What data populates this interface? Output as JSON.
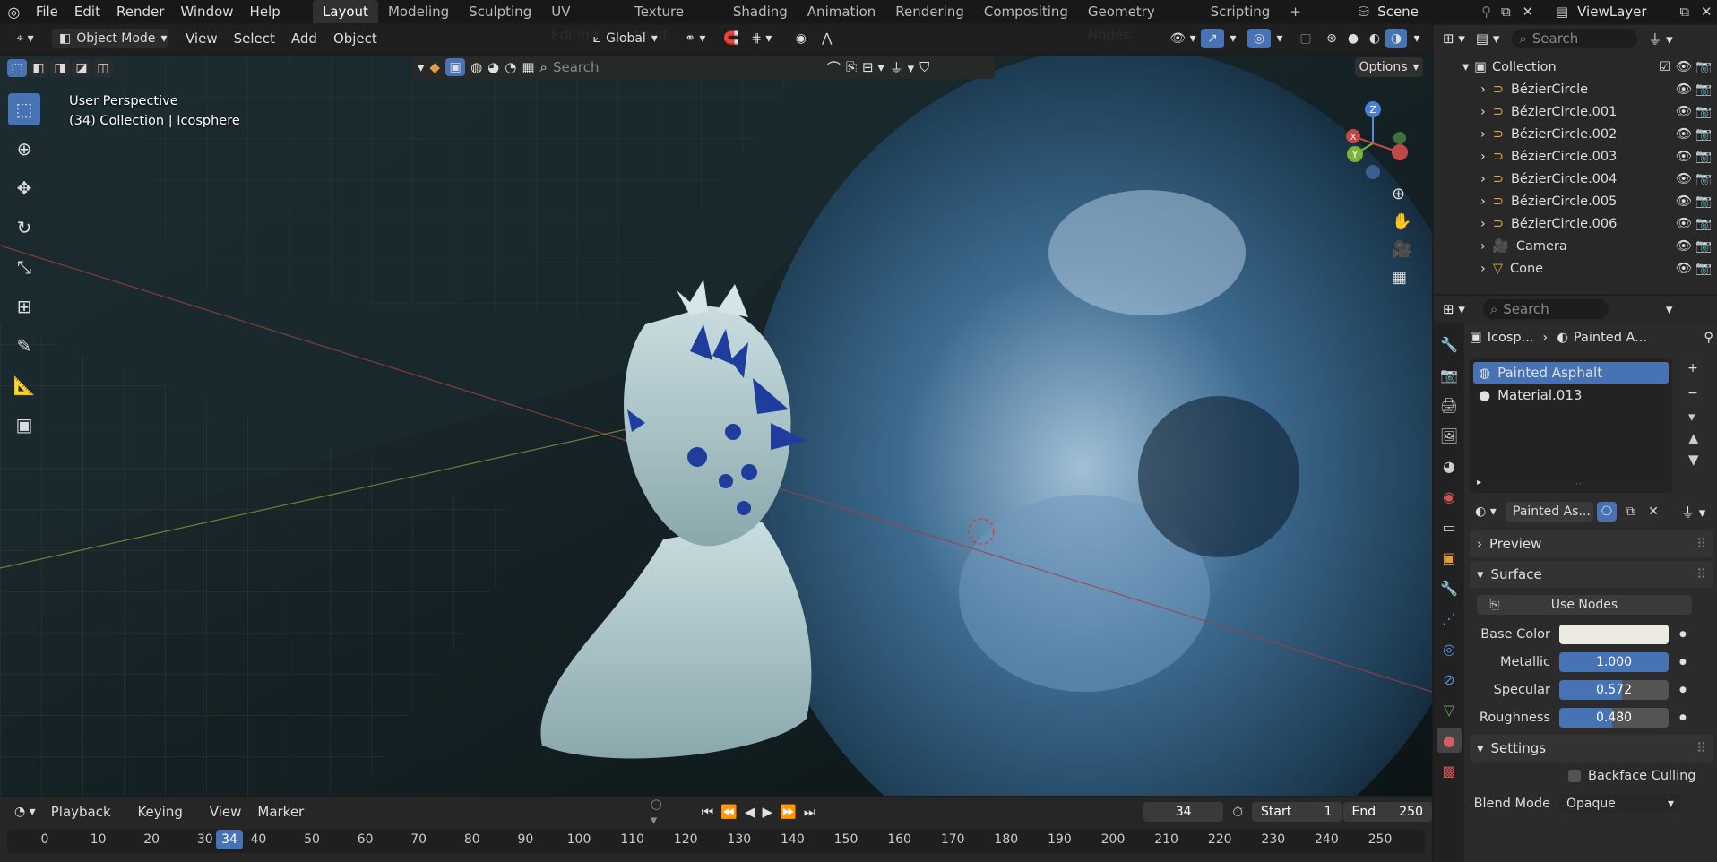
{
  "topbar": {
    "menus": [
      "File",
      "Edit",
      "Render",
      "Window",
      "Help"
    ],
    "workspaces": [
      "Layout",
      "Modeling",
      "Sculpting",
      "UV Editing",
      "Texture Paint",
      "Shading",
      "Animation",
      "Rendering",
      "Compositing",
      "Geometry Nodes",
      "Scripting"
    ],
    "active_workspace": "Layout",
    "scene": "Scene",
    "view_layer": "ViewLayer"
  },
  "viewport_header": {
    "mode": "Object Mode",
    "menus": [
      "View",
      "Select",
      "Add",
      "Object"
    ],
    "orientation": "Global",
    "search_placeholder": "Search",
    "options_label": "Options"
  },
  "viewport": {
    "perspective_label": "User Perspective",
    "collection_label": "(34) Collection | Icosphere"
  },
  "gizmo": {
    "x": "X",
    "y": "Y",
    "z": "Z"
  },
  "timeline": {
    "menus": [
      "Playback",
      "Keying",
      "View",
      "Marker"
    ],
    "current_frame": "34",
    "start_label": "Start",
    "start": "1",
    "end_label": "End",
    "end": "250",
    "ruler": [
      "0",
      "10",
      "20",
      "30",
      "40",
      "50",
      "60",
      "70",
      "80",
      "90",
      "100",
      "110",
      "120",
      "130",
      "140",
      "150",
      "160",
      "170",
      "180",
      "190",
      "200",
      "210",
      "220",
      "230",
      "240",
      "250"
    ]
  },
  "outliner": {
    "search_placeholder": "Search",
    "collection": "Collection",
    "items": [
      {
        "name": "BézierCircle"
      },
      {
        "name": "BézierCircle.001"
      },
      {
        "name": "BézierCircle.002"
      },
      {
        "name": "BézierCircle.003"
      },
      {
        "name": "BézierCircle.004"
      },
      {
        "name": "BézierCircle.005"
      },
      {
        "name": "BézierCircle.006"
      },
      {
        "name": "Camera"
      },
      {
        "name": "Cone"
      }
    ]
  },
  "properties": {
    "search_placeholder": "Search",
    "breadcrumb_object": "Icosp...",
    "breadcrumb_material": "Painted A...",
    "material_slots": [
      "Painted Asphalt",
      "Material.013"
    ],
    "material_name": "Painted As...",
    "panels": {
      "preview": "Preview",
      "surface": "Surface",
      "settings": "Settings"
    },
    "use_nodes_label": "Use Nodes",
    "base_color_label": "Base Color",
    "base_color": "#ecebe2",
    "metallic_label": "Metallic",
    "metallic": "1.000",
    "metallic_fraction": 1.0,
    "specular_label": "Specular",
    "specular": "0.572",
    "specular_fraction": 0.572,
    "roughness_label": "Roughness",
    "roughness": "0.480",
    "roughness_fraction": 0.48,
    "backface_label": "Backface Culling",
    "blend_mode_label": "Blend Mode",
    "blend_mode": "Opaque"
  },
  "colors": {
    "accent": "#4772b3",
    "panel": "#2b2b2b",
    "header": "#181818"
  }
}
